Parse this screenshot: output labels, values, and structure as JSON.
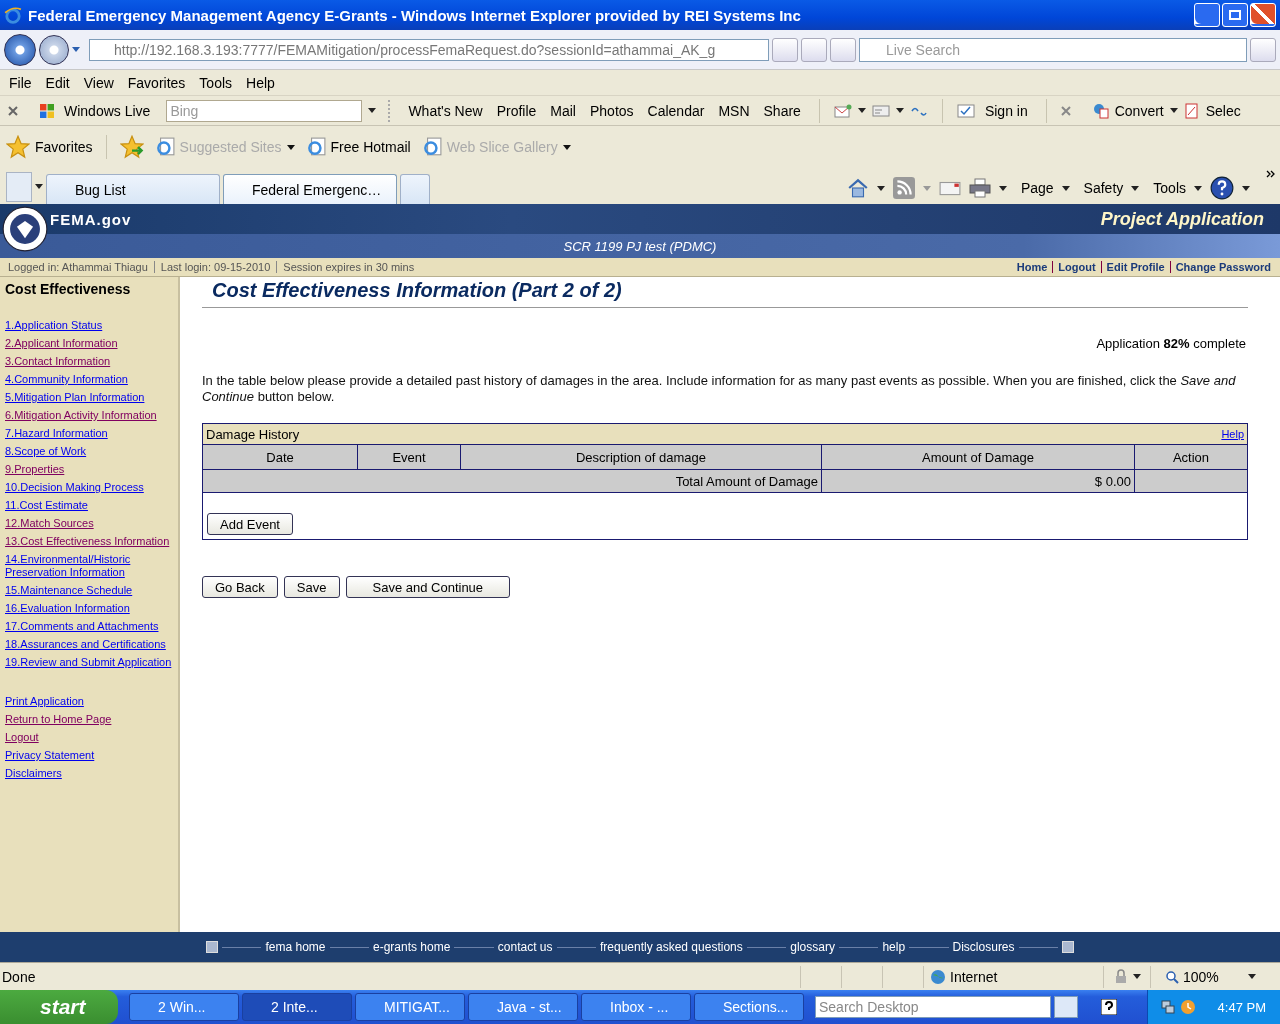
{
  "window": {
    "title": "Federal Emergency Management Agency E-Grants - Windows Internet Explorer provided by REI Systems Inc"
  },
  "address_bar": {
    "url": "http://192.168.3.193:7777/FEMAMitigation/processFemaRequest.do?sessionId=athammai_AK_g",
    "search_placeholder": "Live Search"
  },
  "menu": [
    "File",
    "Edit",
    "View",
    "Favorites",
    "Tools",
    "Help"
  ],
  "live_toolbar": {
    "brand": "Windows Live",
    "search_placeholder": "Bing",
    "links": [
      "What's New",
      "Profile",
      "Mail",
      "Photos",
      "Calendar",
      "MSN",
      "Share"
    ],
    "sign_in": "Sign in",
    "convert": "Convert",
    "select": "Selec"
  },
  "favorites_bar": {
    "label": "Favorites",
    "items": [
      {
        "label": "Suggested Sites",
        "disabled": true,
        "menu": true
      },
      {
        "label": "Free Hotmail",
        "disabled": false,
        "menu": false
      },
      {
        "label": "Web Slice Gallery",
        "disabled": true,
        "menu": true
      }
    ]
  },
  "tabs": [
    {
      "label": "Bug List",
      "selected": false
    },
    {
      "label": "Federal Emergenc…",
      "selected": true
    }
  ],
  "command_bar": [
    "Page",
    "Safety",
    "Tools"
  ],
  "site": {
    "logo": "FEMA.gov",
    "section": "Project Application",
    "subtitle": "SCR 1199 PJ test (PDMC)",
    "info": [
      "Logged in: Athammai Thiagu",
      "Last login: 09-15-2010",
      "Session expires in 30 mins"
    ],
    "user_links": [
      "Home",
      "Logout",
      "Edit Profile",
      "Change Password"
    ]
  },
  "sidebar": {
    "heading": "Cost Effectiveness",
    "steps": [
      {
        "label": "1.Application Status",
        "visited": false
      },
      {
        "label": "2.Applicant Information",
        "visited": true
      },
      {
        "label": "3.Contact Information",
        "visited": true
      },
      {
        "label": "4.Community Information",
        "visited": false
      },
      {
        "label": "5.Mitigation Plan Information",
        "visited": false
      },
      {
        "label": "6.Mitigation Activity Information",
        "visited": true
      },
      {
        "label": "7.Hazard Information",
        "visited": false
      },
      {
        "label": "8.Scope of Work",
        "visited": false
      },
      {
        "label": "9.Properties",
        "visited": true
      },
      {
        "label": "10.Decision Making Process",
        "visited": false
      },
      {
        "label": "11.Cost Estimate",
        "visited": false
      },
      {
        "label": "12.Match Sources",
        "visited": true
      },
      {
        "label": "13.Cost Effectiveness Information",
        "visited": true
      },
      {
        "label": "14.Environmental/Historic Preservation Information",
        "visited": false
      },
      {
        "label": "15.Maintenance Schedule",
        "visited": false
      },
      {
        "label": "16.Evaluation Information",
        "visited": false
      },
      {
        "label": "17.Comments and Attachments",
        "visited": false
      },
      {
        "label": "18.Assurances and Certifications",
        "visited": false
      },
      {
        "label": "19.Review and Submit Application",
        "visited": false
      }
    ],
    "links": [
      {
        "label": "Print Application",
        "visited": false
      },
      {
        "label": "Return to Home Page",
        "visited": true
      },
      {
        "label": "Logout",
        "visited": true
      },
      {
        "label": "Privacy Statement",
        "visited": false
      },
      {
        "label": "Disclaimers",
        "visited": false
      }
    ]
  },
  "content": {
    "title": "Cost Effectiveness Information (Part 2 of 2)",
    "progress": "Application **82%** complete",
    "intro": "In the table below please provide a detailed past history of damages in the area. Include information for as many past events as possible. When you are finished, click the *Save and Continue* button below.",
    "table": {
      "title": "Damage History",
      "help": "Help",
      "columns": [
        "Date",
        "Event",
        "Description of damage",
        "Amount of Damage",
        "Action"
      ],
      "total_label": "Total Amount of Damage",
      "total_value": "$ 0.00",
      "add_button": "Add Event"
    },
    "buttons": [
      "Go Back",
      "Save",
      "Save and Continue"
    ]
  },
  "footer": [
    "fema home",
    "e-grants home",
    "contact us",
    "frequently asked questions",
    "glossary",
    "help",
    "Disclosures"
  ],
  "status_bar": {
    "text": "Done",
    "zone": "Internet",
    "zoom": "100%"
  },
  "taskbar": {
    "start": "start",
    "tasks": [
      {
        "label": "2 Win...",
        "selected": false
      },
      {
        "label": "2 Inte...",
        "selected": true
      },
      {
        "label": "MITIGAT...",
        "selected": false
      },
      {
        "label": "Java - st...",
        "selected": false
      },
      {
        "label": "Inbox - ...",
        "selected": false
      },
      {
        "label": "Sections...",
        "selected": false
      }
    ],
    "search_placeholder": "Search Desktop",
    "time": "4:47 PM"
  }
}
